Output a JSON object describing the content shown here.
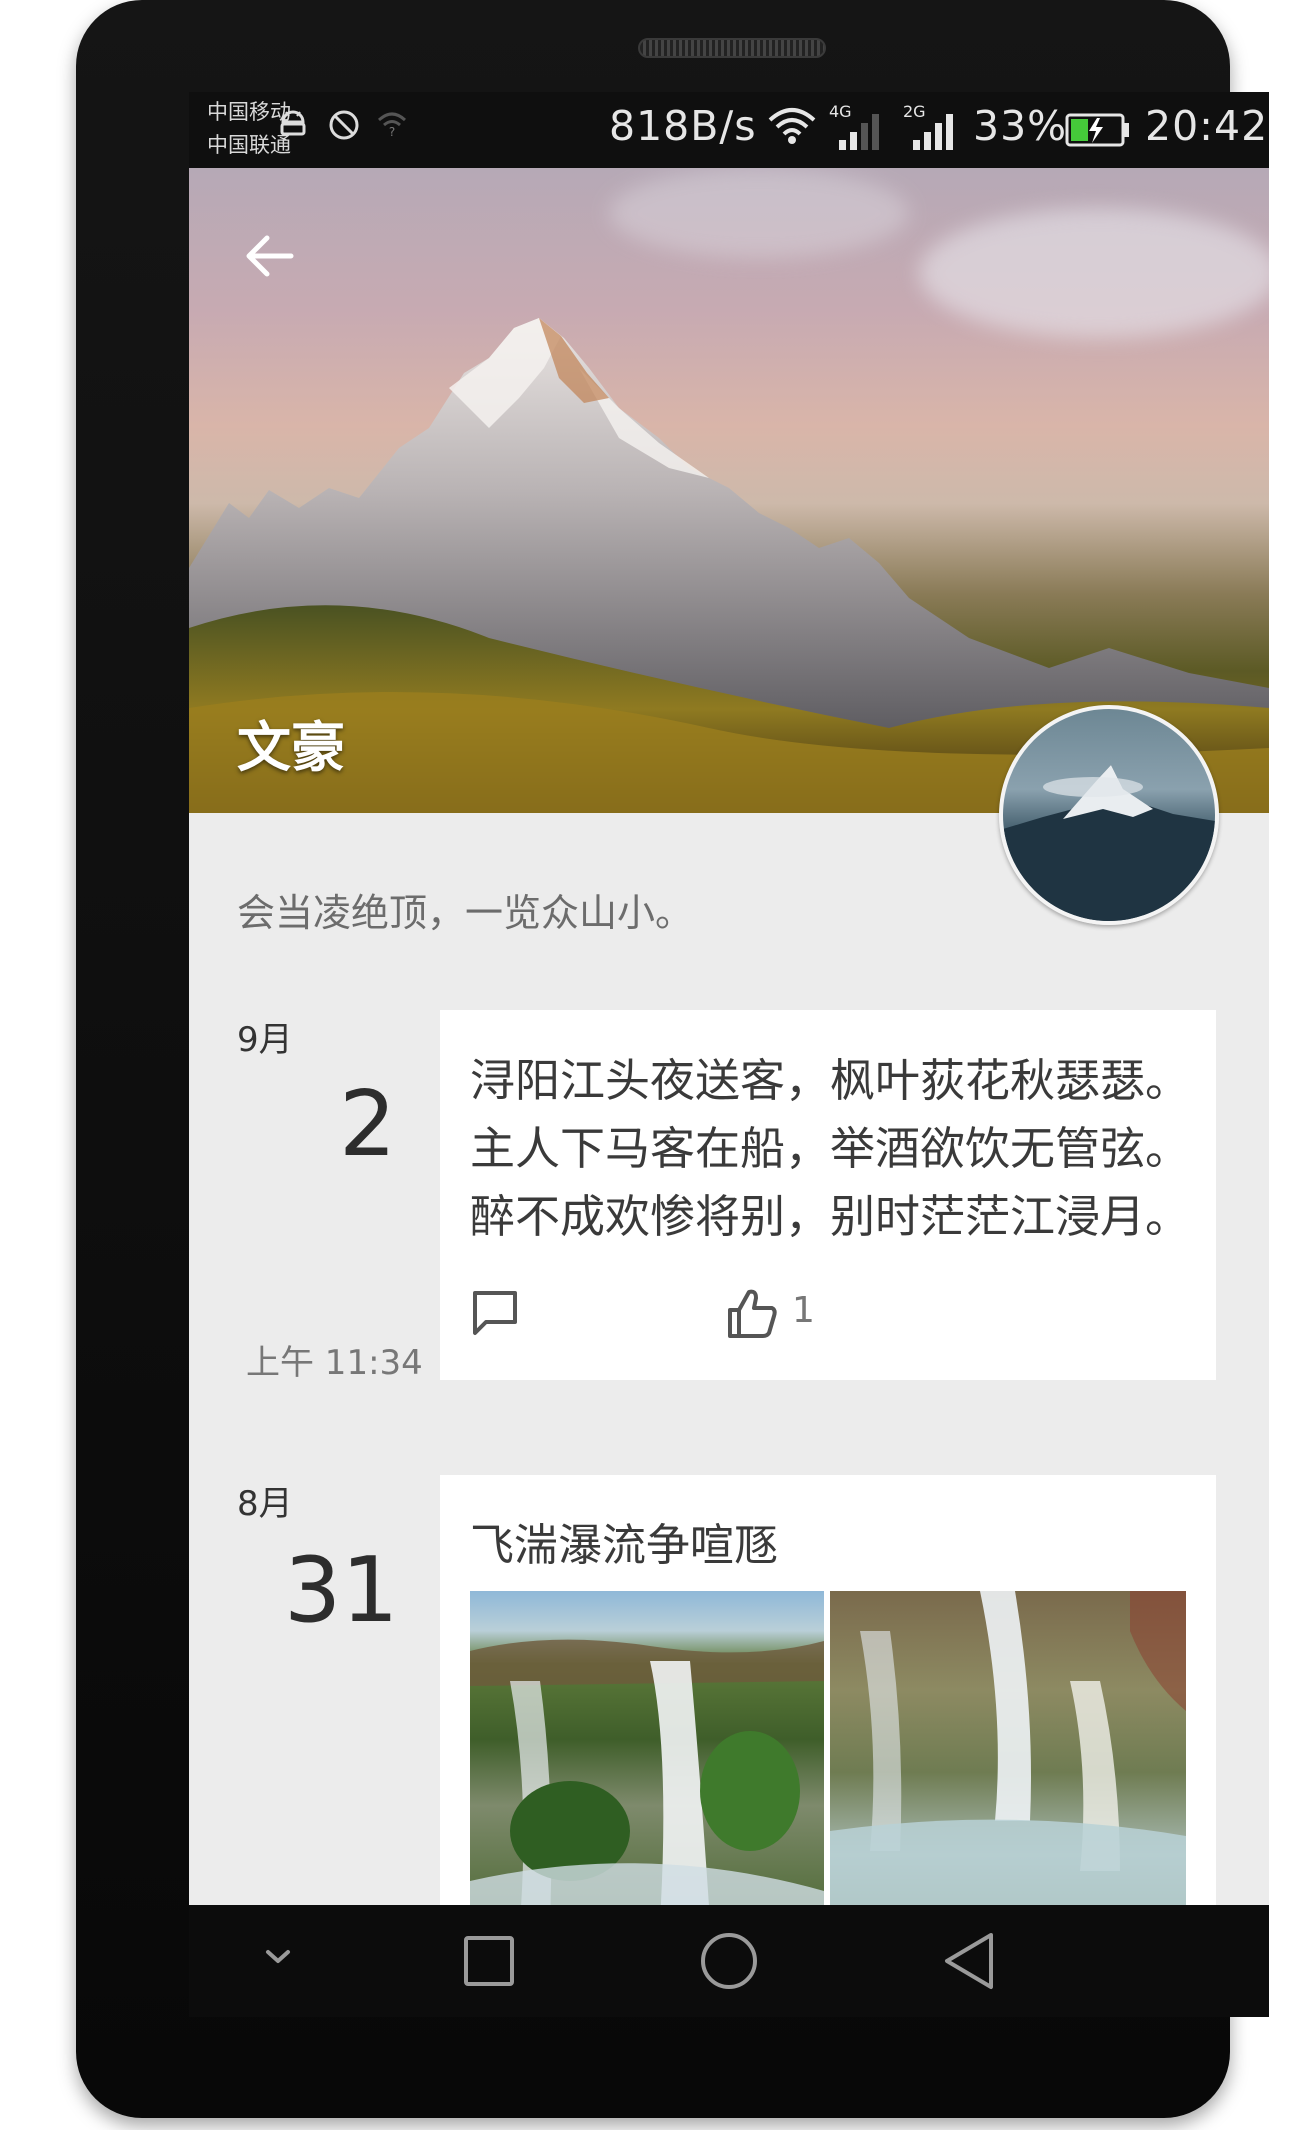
{
  "statusbar": {
    "carrier_top": "中国移动",
    "carrier_bottom": "中国联通",
    "net_speed": "818B/s",
    "signal1_label": "4G",
    "signal2_label": "2G",
    "battery_percent": "33%",
    "time": "20:42",
    "icons": [
      "android-debug-icon",
      "block-icon",
      "wifi-question-icon",
      "wifi-icon",
      "signal-icon",
      "battery-charging-icon"
    ]
  },
  "header": {
    "title": "文豪",
    "back_icon": "arrow-left-icon"
  },
  "profile": {
    "motto": "会当凌绝顶，一览众山小。"
  },
  "posts": [
    {
      "month": "9月",
      "day": "2",
      "time": "上午 11:34",
      "lines": [
        "浔阳江头夜送客，枫叶荻花秋瑟瑟。",
        "主人下马客在船，举酒欲饮无管弦。",
        "醉不成欢惨将别，别时茫茫江浸月。"
      ],
      "like_count": "1"
    },
    {
      "month": "8月",
      "day": "31",
      "title": "飞湍瀑流争喧豗"
    }
  ],
  "navbar": {
    "icons": [
      "chevron-down-icon",
      "recent-apps-icon",
      "home-icon",
      "back-icon"
    ]
  }
}
